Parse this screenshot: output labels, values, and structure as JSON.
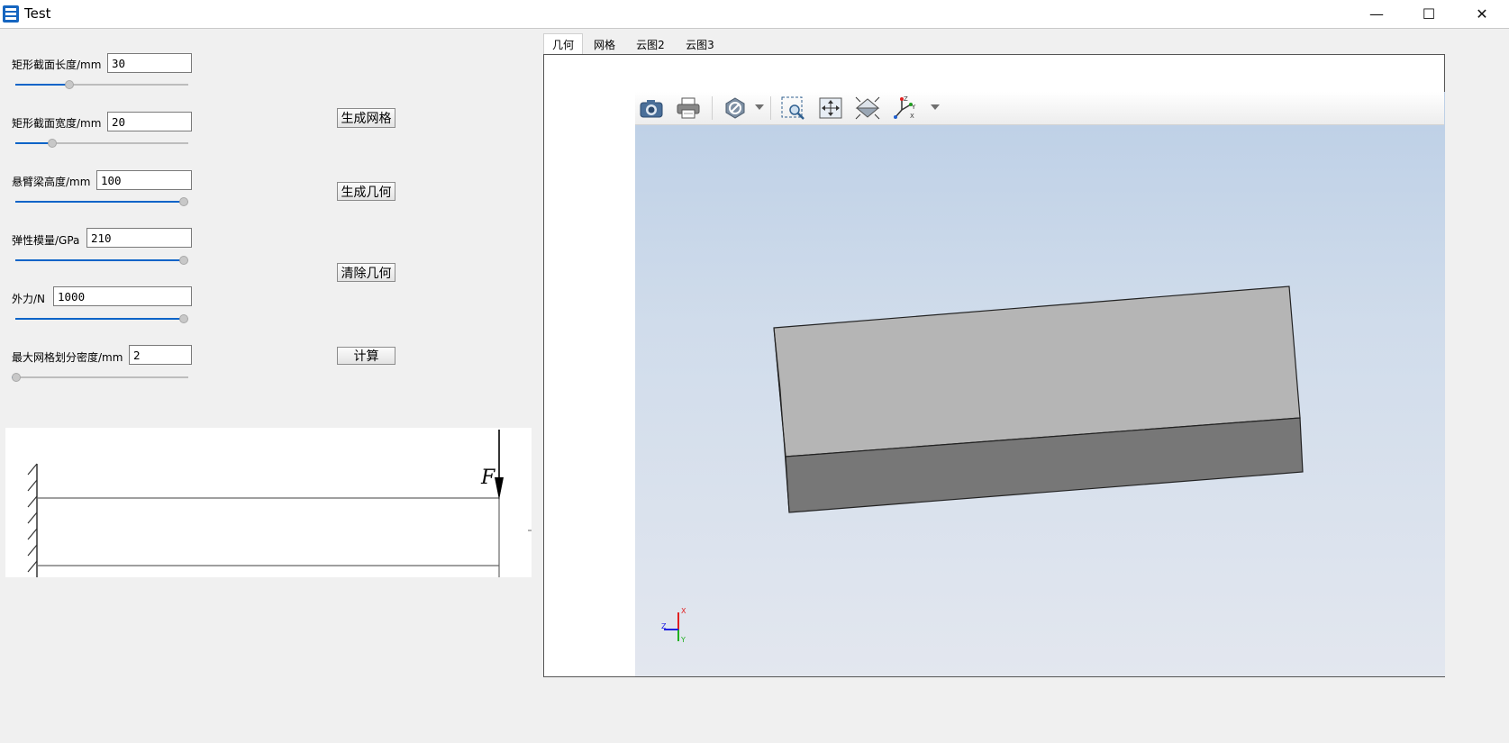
{
  "window": {
    "title": "Test",
    "minimize_glyph": "—",
    "maximize_glyph": "☐",
    "close_glyph": "✕"
  },
  "params": [
    {
      "label": "矩形截面长度/mm",
      "value": "30",
      "slider_fraction": 0.3
    },
    {
      "label": "矩形截面宽度/mm",
      "value": "20",
      "slider_fraction": 0.2
    },
    {
      "label": "悬臂梁高度/mm",
      "value": "100",
      "slider_fraction": 1.0
    },
    {
      "label": "弹性模量/GPa",
      "value": "210",
      "slider_fraction": 1.0
    },
    {
      "label": "外力/N",
      "value": "1000",
      "slider_fraction": 1.0
    },
    {
      "label": "最大网格划分密度/mm",
      "value": "2",
      "slider_fraction": 0.0
    }
  ],
  "buttons": {
    "mesh": "生成网格",
    "geometry": "生成几何",
    "clear": "清除几何",
    "compute": "计算"
  },
  "diagram": {
    "force_label": "F"
  },
  "tabs": [
    "几何",
    "网格",
    "云图2",
    "云图3"
  ],
  "active_tab": 0,
  "viewer": {
    "toolbar_icons": [
      "camera-icon",
      "print-icon",
      "clip-plane-icon",
      "zoom-window-icon",
      "fit-all-icon",
      "view-orientation-icon",
      "axes-icon"
    ],
    "triad_labels": {
      "x": "X",
      "y": "Y",
      "z": "Z"
    }
  },
  "colors": {
    "slider_fill": "#0a64c8",
    "viewer_top": "#bccfe6",
    "viewer_bottom": "#e3e7ef",
    "box_top_face": "#b5b5b5",
    "box_front_face": "#777777"
  }
}
